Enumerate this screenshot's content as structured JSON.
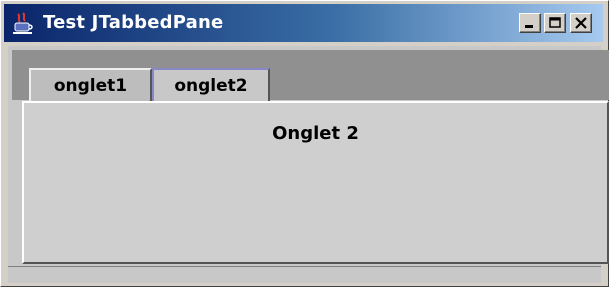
{
  "window": {
    "title": "Test JTabbedPane",
    "icon": "java-coffee-cup-icon",
    "controls": [
      "minimize-icon",
      "maximize-icon",
      "close-icon"
    ]
  },
  "tabs": [
    {
      "label": "onglet1",
      "selected": false
    },
    {
      "label": "onglet2",
      "selected": true
    }
  ],
  "panel": {
    "label": "Onglet 2"
  },
  "colors": {
    "titlebar_start": "#0a246a",
    "titlebar_end": "#a6caf0",
    "panel_background": "#cfcfcf",
    "tab_strip": "#909090"
  }
}
